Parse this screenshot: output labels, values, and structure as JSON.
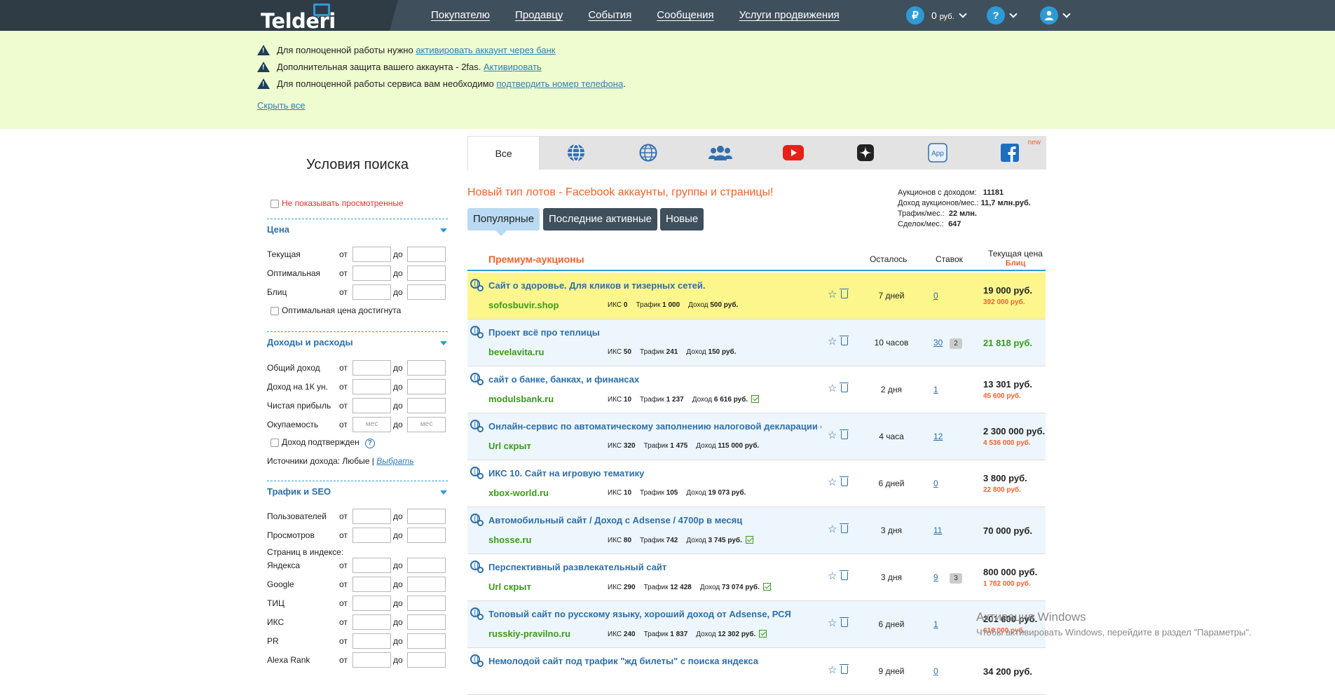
{
  "header": {
    "logo": "Telderi",
    "nav": [
      "Покупателю",
      "Продавцу",
      "События",
      "Сообщения",
      "Услуги продвижения"
    ],
    "balance_symbol": "₽",
    "balance_value": "0",
    "balance_unit": "руб.",
    "help_symbol": "?"
  },
  "notices": {
    "line1_text": "Для полноценной работы нужно ",
    "line1_link": "активировать аккаунт через банк",
    "line2_text": "Дополнительная защита вашего аккаунта - 2fas. ",
    "line2_link": "Активировать",
    "line3_text": "Для полноценной работы сервиса вам необходимо ",
    "line3_link": "подтвердить номер телефона",
    "line3_tail": ".",
    "hide_all": "Скрыть все"
  },
  "sidebar": {
    "title": "Условия поиска",
    "hide_viewed": "Не показывать просмотренные",
    "from": "от",
    "to": "до",
    "price_header": "Цена",
    "price_rows": [
      "Текущая",
      "Оптимальная",
      "Блиц"
    ],
    "optimal_reached": "Оптимальная цена достигнута",
    "income_header": "Доходы и расходы",
    "income_rows": [
      "Общий доход",
      "Доход на 1К ун.",
      "Чистая прибыль",
      "Окупаемость"
    ],
    "month_placeholder": "мес",
    "income_confirmed": "Доход подтвержден",
    "income_sources_label": "Источники дохода: Любые | ",
    "income_sources_link": "Выбрать",
    "traffic_header": "Трафик и SEO",
    "traffic_rows": [
      "Пользователей",
      "Просмотров"
    ],
    "index_pages": "Страниц в индексе:",
    "seo_rows": [
      "Яндекса",
      "Google",
      "ТИЦ",
      "ИКС",
      "PR",
      "Alexa Rank"
    ]
  },
  "tabs": {
    "all": "Все",
    "new_badge": "new",
    "icons": [
      "globe-icon",
      "globe-outline-icon",
      "group-icon",
      "youtube-icon",
      "zen-icon",
      "app-icon",
      "facebook-icon"
    ],
    "app_label": "App"
  },
  "promo": "Новый тип лотов - Facebook аккаунты, группы и страницы!",
  "stats": {
    "l1": "Аукционов с доходом:",
    "v1": "11181",
    "l2": "Доход аукционов/мес.:",
    "v2": "11,7 млн.руб.",
    "l3": "Трафик/мес.:",
    "v3": "22 млн.",
    "l4": "Сделок/мес.:",
    "v4": "647"
  },
  "filters": [
    "Популярные",
    "Последние активные",
    "Новые"
  ],
  "table": {
    "title": "Премиум-аукционы",
    "col_left": "Осталось",
    "col_bids": "Ставок",
    "col_price": "Текущая цена",
    "col_blitz": "Блиц",
    "iks_label": "ИКС",
    "traffic_label": "Трафик",
    "income_label": "Доход",
    "rows": [
      {
        "title": "Сайт о здоровье. Для кликов и тизерных сетей.",
        "domain": "sofosbuvir.shop",
        "iks": "0",
        "traffic": "1 000",
        "income": "500 руб.",
        "left": "7 дней",
        "bids": "0",
        "price": "19 000 руб.",
        "blitz": "392 000 руб."
      },
      {
        "title": "Проект всё про теплицы",
        "domain": "bevelavita.ru",
        "iks": "50",
        "traffic": "241",
        "income": "150 руб.",
        "left": "10 часов",
        "bids": "30",
        "bubble": "2",
        "price": "21 818 руб.",
        "blitz": ""
      },
      {
        "title": "сайт о банке, банках, и финансах",
        "domain": "modulsbank.ru",
        "iks": "10",
        "traffic": "1 237",
        "income": "6 616 руб.",
        "left": "2 дня",
        "bids": "1",
        "price": "13 301 руб.",
        "blitz": "45 600 руб."
      },
      {
        "title": "Онлайн-сервис по автоматическому заполнению налоговой декларации о",
        "domain": "Url скрыт",
        "iks": "320",
        "traffic": "1 475",
        "income": "115 000 руб.",
        "left": "4 часа",
        "bids": "12",
        "price": "2 300 000 руб.",
        "blitz": "4 536 000 руб."
      },
      {
        "title": "ИКС 10. Сайт на игровую тематику",
        "domain": "xbox-world.ru",
        "iks": "10",
        "traffic": "105",
        "income": "19 073 руб.",
        "left": "6 дней",
        "bids": "0",
        "price": "3 800 руб.",
        "blitz": "22 800 руб."
      },
      {
        "title": "Автомобильный сайт / Доход с Adsense / 4700р в месяц",
        "domain": "shosse.ru",
        "iks": "80",
        "traffic": "742",
        "income": "3 745 руб.",
        "left": "3 дня",
        "bids": "11",
        "price": "70 000 руб.",
        "blitz": ""
      },
      {
        "title": "Перспективный развлекательный сайт",
        "domain": "Url скрыт",
        "iks": "290",
        "traffic": "12 428",
        "income": "73 074 руб.",
        "left": "3 дня",
        "bids": "9",
        "bubble": "3",
        "price": "800 000 руб.",
        "blitz": "1 782 000 руб."
      },
      {
        "title": "Топовый сайт по русскому языку, хороший доход от Adsense, РСЯ",
        "domain": "russkiy-pravilno.ru",
        "iks": "240",
        "traffic": "1 837",
        "income": "12 302 руб.",
        "left": "6 дней",
        "bids": "1",
        "price": "201 600 руб.",
        "blitz": "616 000 руб."
      },
      {
        "title": "Немолодой сайт под трафик \"жд билеты\" с поиска яндекса",
        "domain": "",
        "iks": "",
        "traffic": "",
        "income": "",
        "left": "9 дней",
        "bids": "0",
        "price": "34 200 руб.",
        "blitz": ""
      }
    ]
  },
  "watermark": {
    "line1": "Активация Windows",
    "line2": "Чтобы активировать Windows, перейдите в раздел \"Параметры\"."
  }
}
